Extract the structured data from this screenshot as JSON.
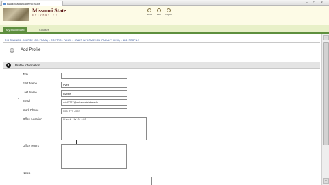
{
  "window": {
    "tab_title": "Blackboard Academic Suite",
    "controls": [
      "–",
      "□",
      "×"
    ]
  },
  "header": {
    "logo_main": "Missouri State",
    "logo_sub": "UNIVERSITY",
    "links": [
      {
        "label": "Home",
        "icon": "home-icon"
      },
      {
        "label": "Help",
        "icon": "help-icon"
      },
      {
        "label": "Logout",
        "icon": "logout-icon"
      }
    ]
  },
  "tabs": [
    {
      "label": "My Blackboard",
      "active": true
    },
    {
      "label": "Courses",
      "active": false
    }
  ],
  "breadcrumb": "CIS TRAINING COURSE (CIS-TRAIN)  >  CONTROL PANEL  >  STAFF INFORMATION (FACULTY LINK)  >  ADD PROFILE",
  "page": {
    "title": "Add Profile",
    "section_number": "1",
    "section_title": "Profile Information"
  },
  "form": {
    "title_label": "Title",
    "title_value": "",
    "first_name_label": "First Name",
    "first_name_value": "Pyee",
    "last_name_label": "Last Name",
    "last_name_value": "Bybee",
    "email_label": "Email",
    "email_value": "ddd7727@missouristate.edu",
    "work_phone_label": "Work Phone",
    "work_phone_value": "555-777-4567",
    "office_location_label": "Office Location",
    "office_location_value": "Cheek Hall 110",
    "office_hours_label": "Office Hours",
    "office_hours_value": "",
    "notes_label": "Notes",
    "notes_value": ""
  },
  "colors": {
    "header_bg": "#fdfbe6",
    "tab_active": "#5e8f3e",
    "logo_text": "#5a1414",
    "breadcrumb_link": "#1d3f8c"
  }
}
